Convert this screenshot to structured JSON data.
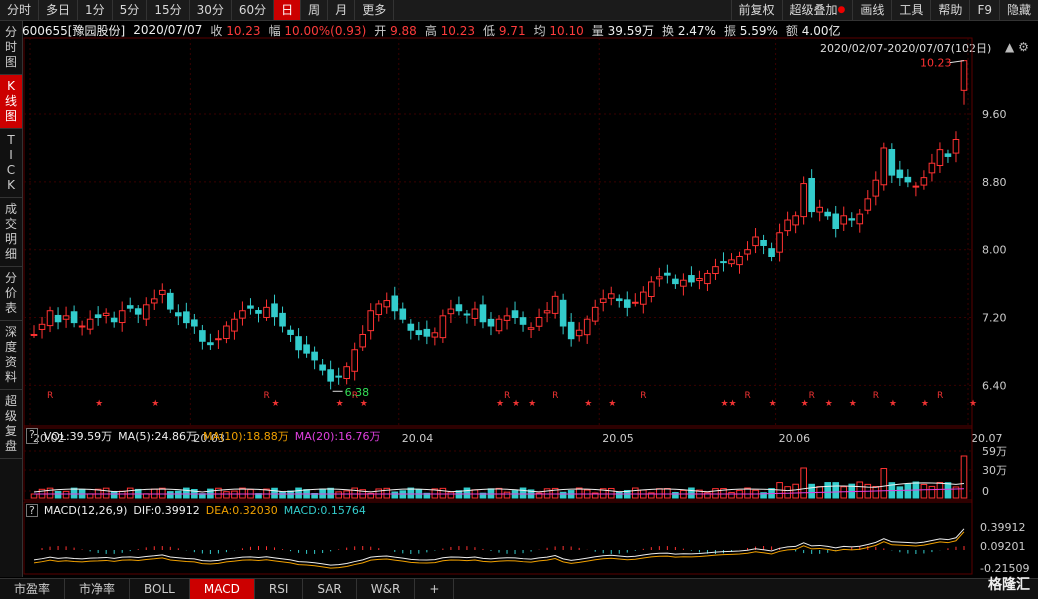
{
  "toolbar": {
    "periods": [
      "分时",
      "多日",
      "1分",
      "5分",
      "15分",
      "30分",
      "60分",
      "日",
      "周",
      "月",
      "更多"
    ],
    "active_period": "日",
    "right": [
      "前复权",
      "超级叠加",
      "画线",
      "工具",
      "帮助",
      "F9",
      "隐藏"
    ]
  },
  "left_nav": [
    {
      "label": "分时图",
      "active": false
    },
    {
      "label": "K线图",
      "active": true
    },
    {
      "label": "TICK",
      "active": false
    },
    {
      "label": "成交明细",
      "active": false
    },
    {
      "label": "分价表",
      "active": false
    },
    {
      "label": "深度资料",
      "active": false
    },
    {
      "label": "超级复盘",
      "active": false
    }
  ],
  "info": {
    "code_name": "600655[豫园股份]",
    "date": "2020/07/07",
    "close_label": "收",
    "close": "10.23",
    "change_label": "幅",
    "change": "10.00%(0.93)",
    "open_label": "开",
    "open": "9.88",
    "high_label": "高",
    "high": "10.23",
    "low_label": "低",
    "low": "9.71",
    "avg_label": "均",
    "avg": "10.10",
    "volume_label": "量",
    "volume": "39.59万",
    "turnover_label": "换",
    "turnover": "2.47%",
    "amplitude_label": "振",
    "amplitude": "5.59%",
    "amount_label": "额",
    "amount": "4.00亿"
  },
  "range": "2020/02/07-2020/07/07(102日)",
  "chart_data": {
    "type": "candlestick",
    "y_ticks": [
      "9.60",
      "8.80",
      "8.00",
      "7.20",
      "6.40"
    ],
    "y_tick_values": [
      9.6,
      8.8,
      8.0,
      7.2,
      6.4
    ],
    "ylim": [
      6.18,
      10.45
    ],
    "x_ticks": [
      "20.02",
      "20.03",
      "20.04",
      "20.05",
      "20.06",
      "20.07"
    ],
    "x_tick_index": [
      0,
      20,
      46,
      71,
      93,
      117
    ],
    "annotations": {
      "high": "10.23",
      "low": "6.38"
    },
    "closes": [
      7.0,
      7.12,
      7.28,
      7.15,
      7.22,
      7.14,
      7.1,
      7.18,
      7.2,
      7.25,
      7.15,
      7.28,
      7.31,
      7.24,
      7.35,
      7.42,
      7.52,
      7.3,
      7.22,
      7.14,
      7.1,
      6.92,
      6.88,
      6.95,
      7.1,
      7.18,
      7.28,
      7.31,
      7.25,
      7.32,
      7.21,
      7.1,
      7.0,
      6.82,
      6.78,
      6.7,
      6.58,
      6.45,
      6.5,
      6.62,
      6.82,
      7.0,
      7.28,
      7.36,
      7.4,
      7.28,
      7.18,
      7.05,
      7.0,
      6.98,
      7.02,
      7.22,
      7.3,
      7.28,
      7.23,
      7.3,
      7.15,
      7.1,
      7.18,
      7.22,
      7.2,
      7.12,
      7.08,
      7.2,
      7.28,
      7.45,
      7.1,
      6.95,
      7.05,
      7.18,
      7.32,
      7.42,
      7.48,
      7.4,
      7.32,
      7.38,
      7.5,
      7.62,
      7.68,
      7.7,
      7.6,
      7.64,
      7.62,
      7.66,
      7.72,
      7.8,
      7.85,
      7.88,
      7.92,
      8.0,
      8.15,
      8.05,
      7.92,
      8.2,
      8.35,
      8.4,
      8.78,
      8.45,
      8.5,
      8.4,
      8.25,
      8.4,
      8.35,
      8.42,
      8.6,
      8.82,
      9.2,
      8.88,
      8.85,
      8.8,
      8.75,
      8.85,
      9.02,
      9.18,
      9.1,
      9.3,
      10.23
    ],
    "volume_ticks": [
      "59万",
      "30万",
      "0"
    ],
    "volume_legend": {
      "vol": "VOL:39.59万",
      "ma5": "MA(5):24.86万",
      "ma10": "MA(10):18.88万",
      "ma20": "MA(20):16.76万"
    },
    "macd_legend": {
      "title": "MACD(12,26,9)",
      "dif": "DIF:0.39912",
      "dea": "DEA:0.32030",
      "macd": "MACD:0.15764"
    },
    "macd_ticks": [
      "0.39912",
      "0.09201",
      "-0.21509"
    ]
  },
  "bottom_tabs": [
    "市盈率",
    "市净率",
    "BOLL",
    "MACD",
    "RSI",
    "SAR",
    "W&R",
    "+"
  ],
  "bottom_active": "MACD",
  "logo": "格隆汇",
  "colors": {
    "up": "#ff3232",
    "down": "#33cccc",
    "bg": "#000000",
    "grid": "#2a0000",
    "active": "#cc0000"
  }
}
